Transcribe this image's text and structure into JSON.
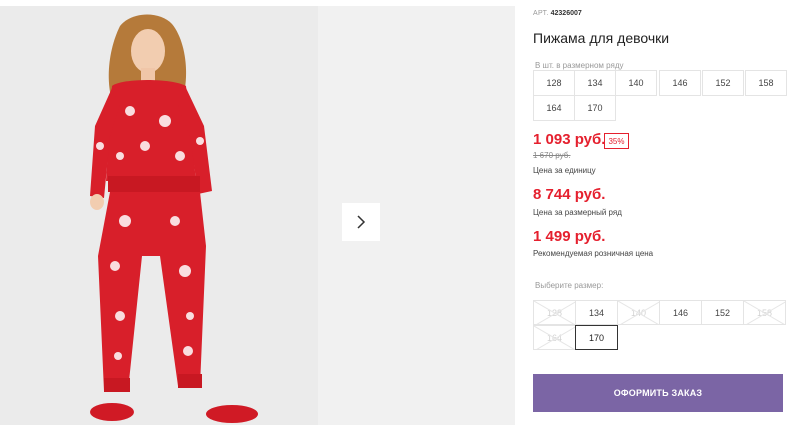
{
  "product": {
    "sku_label": "АРТ.",
    "sku": "42326007",
    "title": "Пижама для девочки"
  },
  "gallery": {
    "next_icon": "chevron-right-icon"
  },
  "size_range": {
    "label": "В шт. в размерном ряду",
    "sizes": [
      "128",
      "134",
      "140",
      "146",
      "152",
      "158",
      "164",
      "170"
    ]
  },
  "prices": {
    "unit_price": "1 093 руб.",
    "discount": "35%",
    "old_price": "1 670 руб.",
    "unit_label": "Цена за единицу",
    "range_price": "8 744 руб.",
    "range_label": "Цена за размерный ряд",
    "retail_price": "1 499 руб.",
    "retail_label": "Рекомендуемая розничная цена"
  },
  "size_choice": {
    "label": "Выберите размер:",
    "sizes": [
      {
        "size": "128",
        "available": false
      },
      {
        "size": "134",
        "available": true
      },
      {
        "size": "140",
        "available": false
      },
      {
        "size": "146",
        "available": true
      },
      {
        "size": "152",
        "available": true
      },
      {
        "size": "158",
        "available": false
      },
      {
        "size": "164",
        "available": false
      },
      {
        "size": "170",
        "available": true,
        "selected": true
      }
    ]
  },
  "order_button": "ОФОРМИТЬ ЗАКАЗ",
  "colors": {
    "price_red": "#e5202e",
    "button_purple": "#7b65a5"
  }
}
